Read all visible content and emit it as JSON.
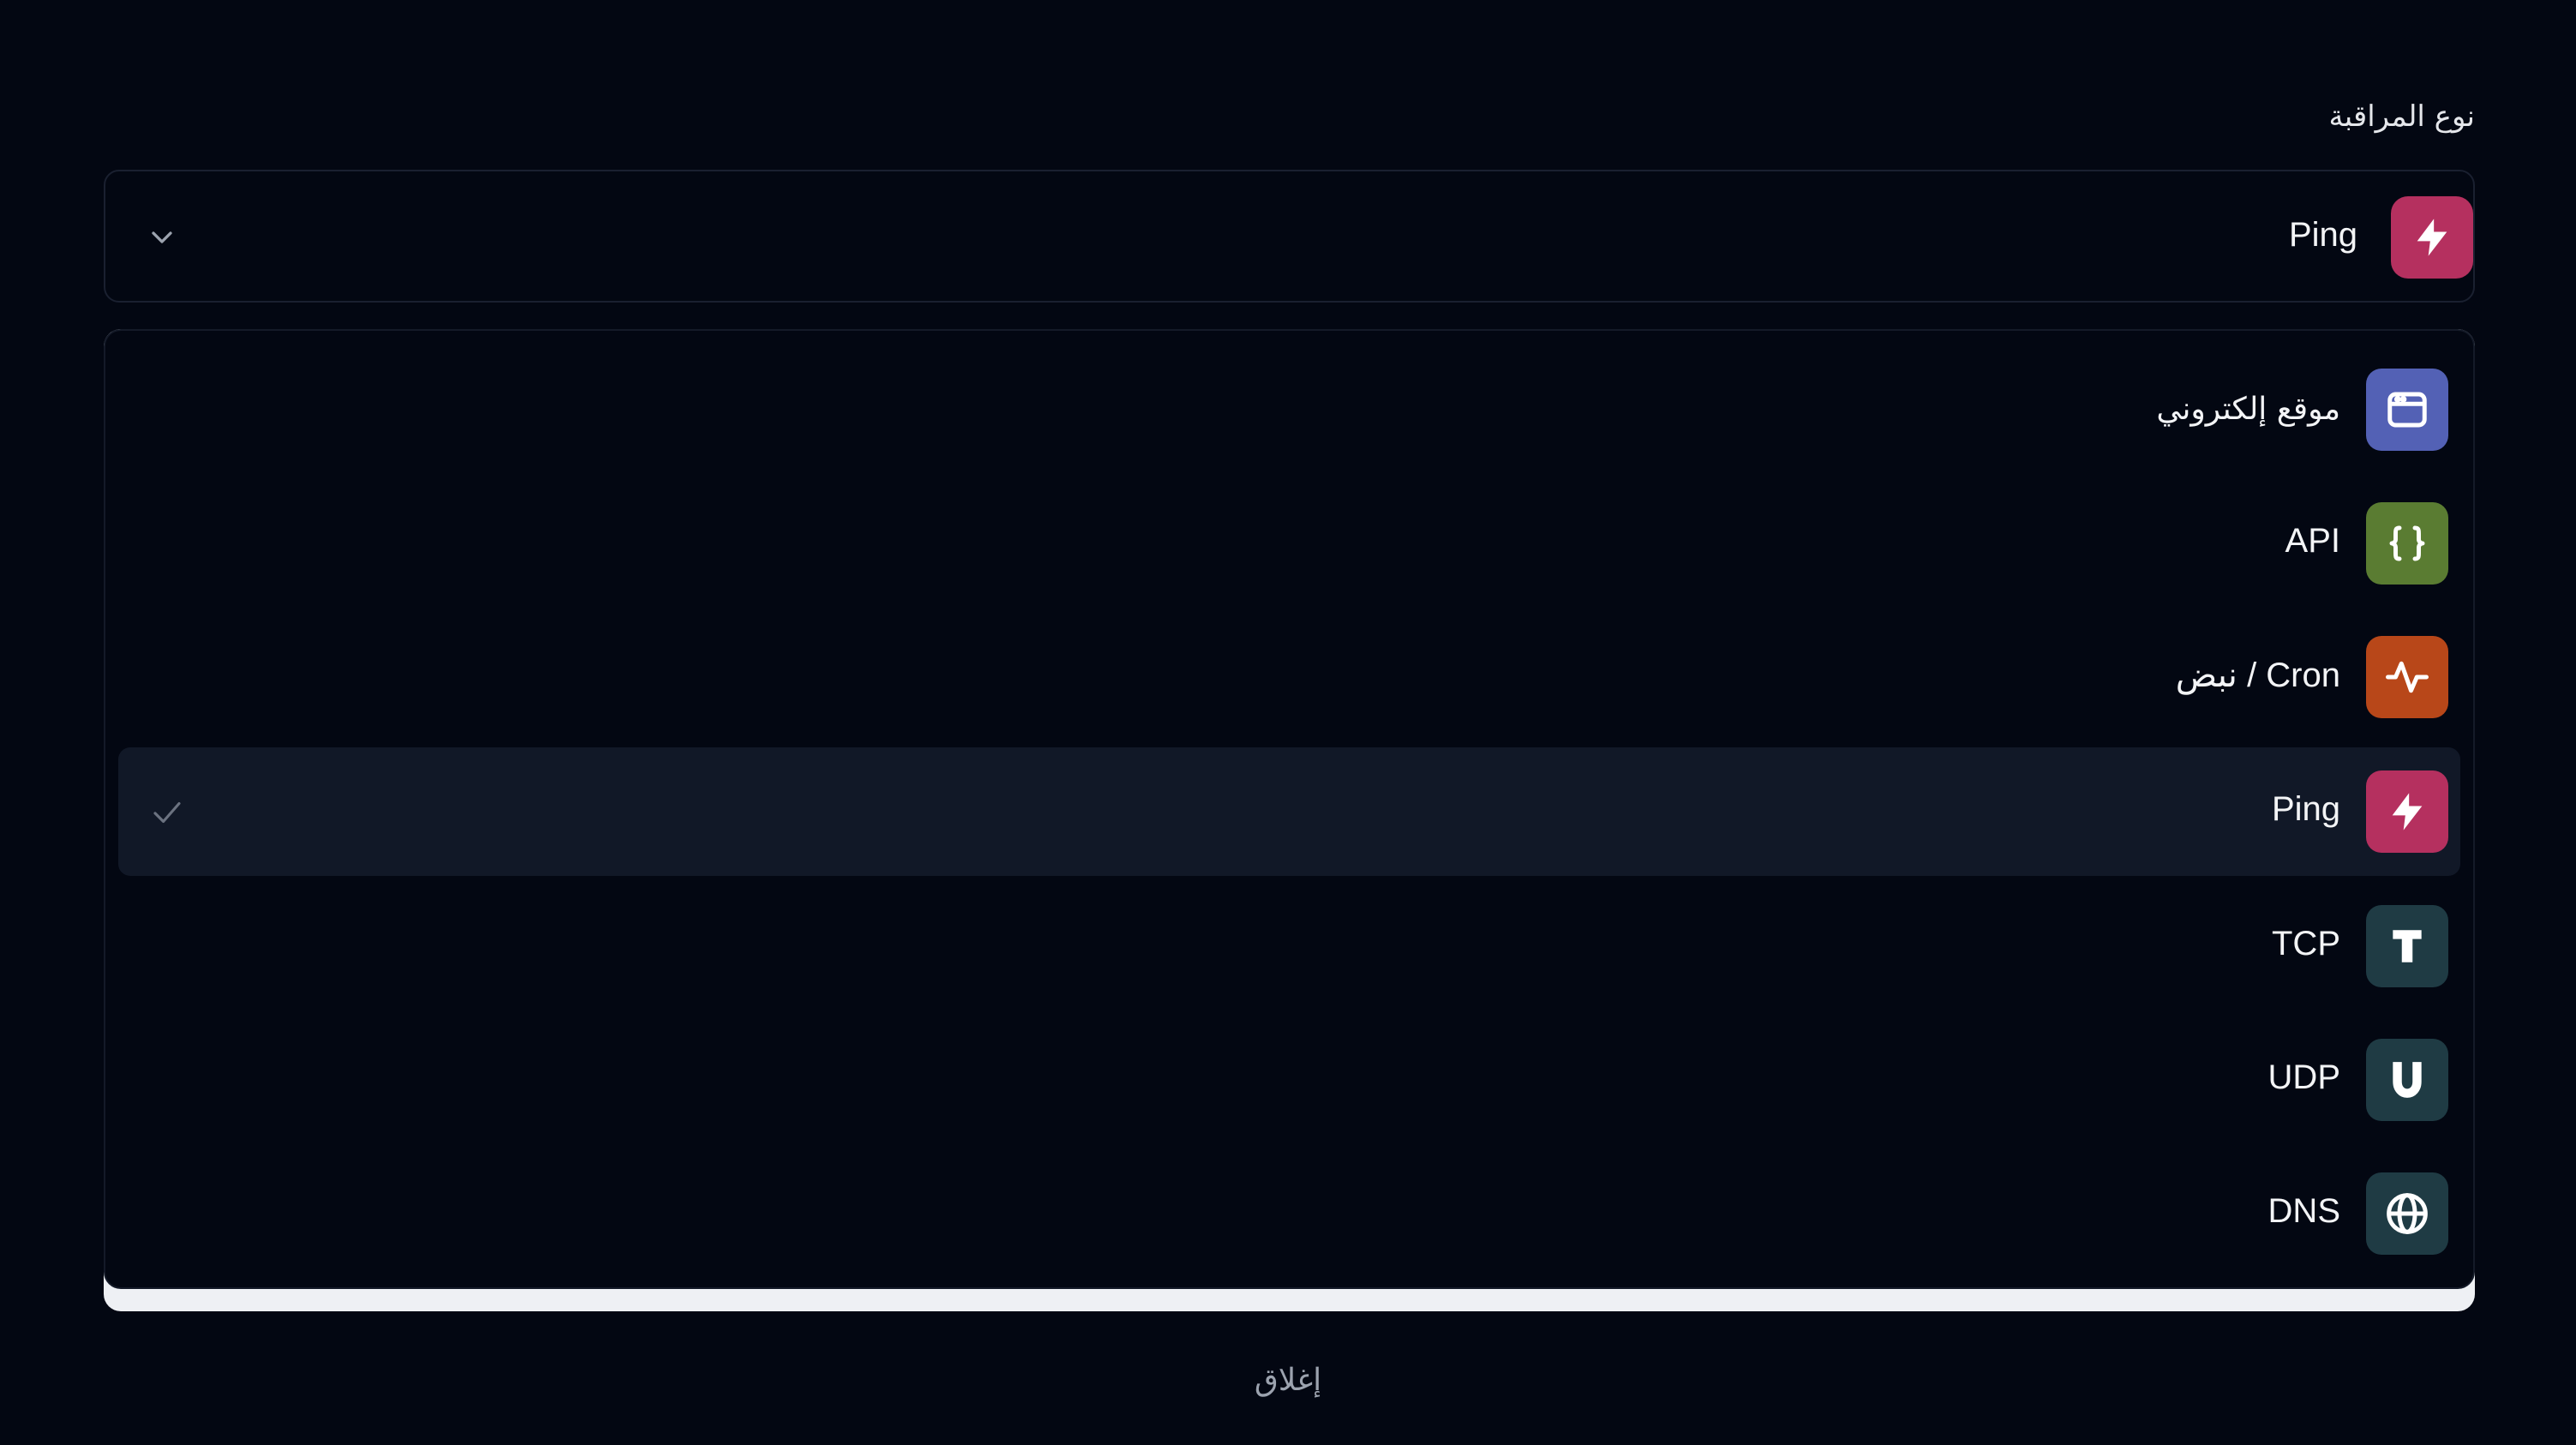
{
  "field": {
    "label": "نوع المراقبة"
  },
  "select": {
    "value": "Ping",
    "icon": "bolt-icon",
    "icon_color": "#b5305f"
  },
  "options": [
    {
      "label": "موقع إلكتروني",
      "icon": "browser-window-icon",
      "color": "#5361b5",
      "selected": false
    },
    {
      "label": "API",
      "icon": "curly-braces-icon",
      "color": "#5a7c32",
      "selected": false
    },
    {
      "label": "نبض / Cron",
      "icon": "pulse-icon",
      "color": "#b84719",
      "selected": false
    },
    {
      "label": "Ping",
      "icon": "bolt-icon",
      "color": "#b5305f",
      "selected": true
    },
    {
      "label": "TCP",
      "icon": "letter-t-icon",
      "color": "#1f3b44",
      "selected": false
    },
    {
      "label": "UDP",
      "icon": "letter-u-icon",
      "color": "#1f3b44",
      "selected": false
    },
    {
      "label": "DNS",
      "icon": "globe-icon",
      "color": "#1f3b44",
      "selected": false
    }
  ],
  "close": {
    "label": "إغلاق"
  },
  "colors": {
    "background": "#030712",
    "selected_row": "#111827",
    "border": "#1a2030"
  }
}
